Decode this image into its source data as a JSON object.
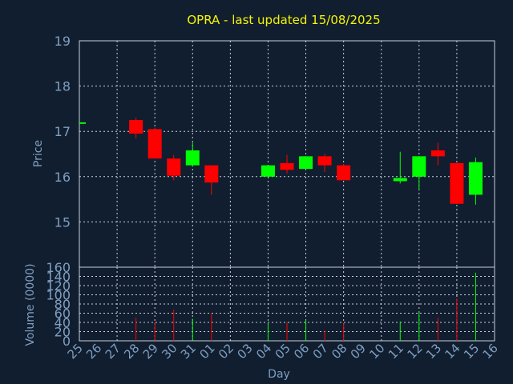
{
  "title": "OPRA - last updated 15/08/2025",
  "colors": {
    "background": "#111e30",
    "title": "#f5f500",
    "axis_text": "#7f9fc0",
    "up": "#00ff00",
    "down": "#ff0000",
    "grid": "#c8d0dc"
  },
  "chart_data": {
    "type": "candlestick",
    "title": "OPRA - last updated 15/08/2025",
    "xlabel": "Day",
    "x_ticks": [
      "25",
      "26",
      "27",
      "28",
      "29",
      "30",
      "31",
      "01",
      "02",
      "03",
      "04",
      "05",
      "06",
      "07",
      "08",
      "09",
      "10",
      "11",
      "12",
      "13",
      "14",
      "15",
      "16"
    ],
    "price": {
      "ylabel": "Price",
      "ylim": [
        14.0,
        19.0
      ],
      "yticks": [
        15,
        16,
        17,
        18,
        19
      ],
      "candles": [
        {
          "day": "25",
          "open": 17.2,
          "high": 17.2,
          "low": 17.2,
          "close": 17.2,
          "dir": "up"
        },
        {
          "day": "28",
          "open": 17.25,
          "high": 17.3,
          "low": 16.85,
          "close": 16.95,
          "dir": "down"
        },
        {
          "day": "29",
          "open": 17.05,
          "high": 17.08,
          "low": 16.4,
          "close": 16.4,
          "dir": "down"
        },
        {
          "day": "30",
          "open": 16.4,
          "high": 16.48,
          "low": 15.92,
          "close": 16.02,
          "dir": "down"
        },
        {
          "day": "31",
          "open": 16.25,
          "high": 16.75,
          "low": 16.22,
          "close": 16.58,
          "dir": "up"
        },
        {
          "day": "01",
          "open": 16.25,
          "high": 16.25,
          "low": 15.6,
          "close": 15.87,
          "dir": "down"
        },
        {
          "day": "04",
          "open": 16.0,
          "high": 16.25,
          "low": 16.0,
          "close": 16.25,
          "dir": "up"
        },
        {
          "day": "05",
          "open": 16.3,
          "high": 16.48,
          "low": 16.07,
          "close": 16.15,
          "dir": "down"
        },
        {
          "day": "06",
          "open": 16.17,
          "high": 16.45,
          "low": 16.17,
          "close": 16.45,
          "dir": "up"
        },
        {
          "day": "07",
          "open": 16.45,
          "high": 16.5,
          "low": 16.1,
          "close": 16.25,
          "dir": "down"
        },
        {
          "day": "08",
          "open": 16.25,
          "high": 16.28,
          "low": 15.92,
          "close": 15.92,
          "dir": "down"
        },
        {
          "day": "11",
          "open": 15.9,
          "high": 16.55,
          "low": 15.85,
          "close": 15.97,
          "dir": "up"
        },
        {
          "day": "12",
          "open": 16.0,
          "high": 16.45,
          "low": 15.72,
          "close": 16.45,
          "dir": "up"
        },
        {
          "day": "13",
          "open": 16.58,
          "high": 16.75,
          "low": 16.25,
          "close": 16.45,
          "dir": "down"
        },
        {
          "day": "14",
          "open": 16.3,
          "high": 16.3,
          "low": 15.4,
          "close": 15.4,
          "dir": "down"
        },
        {
          "day": "15",
          "open": 15.6,
          "high": 16.42,
          "low": 15.38,
          "close": 16.32,
          "dir": "up"
        }
      ]
    },
    "volume": {
      "ylabel": "Volume (0000)",
      "ylim": [
        0,
        160
      ],
      "yticks": [
        0,
        20,
        40,
        60,
        80,
        100,
        120,
        140,
        160
      ],
      "bars": [
        {
          "day": "28",
          "value": 50,
          "dir": "down"
        },
        {
          "day": "29",
          "value": 40,
          "dir": "down"
        },
        {
          "day": "30",
          "value": 68,
          "dir": "down"
        },
        {
          "day": "31",
          "value": 48,
          "dir": "up"
        },
        {
          "day": "01",
          "value": 60,
          "dir": "down"
        },
        {
          "day": "04",
          "value": 38,
          "dir": "up"
        },
        {
          "day": "05",
          "value": 40,
          "dir": "down"
        },
        {
          "day": "06",
          "value": 45,
          "dir": "up"
        },
        {
          "day": "07",
          "value": 22,
          "dir": "down"
        },
        {
          "day": "08",
          "value": 38,
          "dir": "down"
        },
        {
          "day": "11",
          "value": 42,
          "dir": "up"
        },
        {
          "day": "12",
          "value": 62,
          "dir": "up"
        },
        {
          "day": "13",
          "value": 50,
          "dir": "down"
        },
        {
          "day": "14",
          "value": 92,
          "dir": "down"
        },
        {
          "day": "15",
          "value": 148,
          "dir": "up"
        }
      ]
    },
    "grid": true
  }
}
